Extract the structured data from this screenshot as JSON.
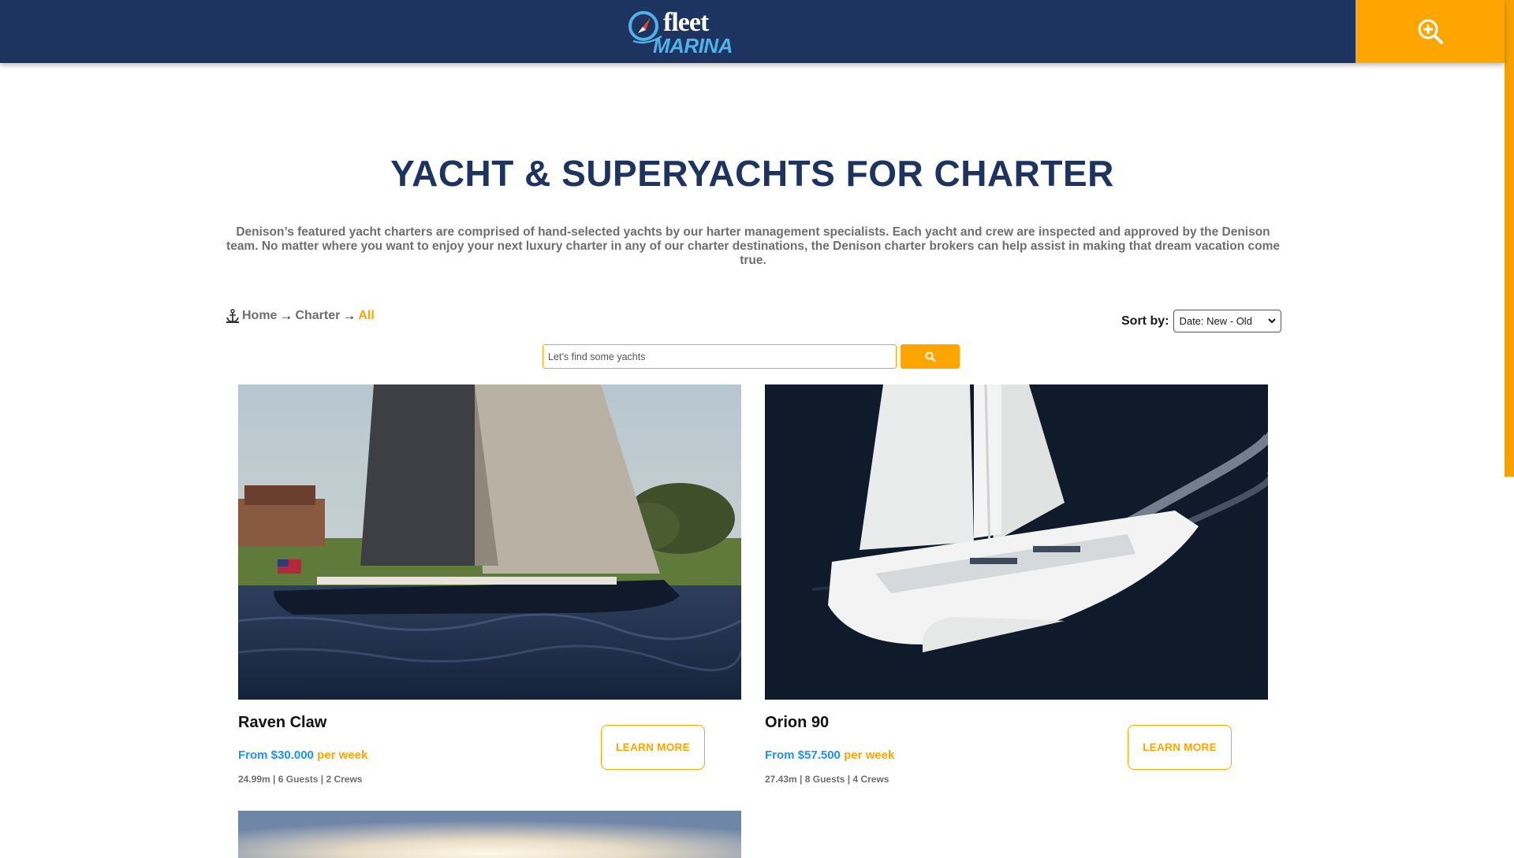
{
  "header": {
    "logo_word1": "fleet",
    "logo_word2": "MARINA",
    "search_icon": "zoom-in-icon",
    "colors": {
      "navy": "#1d3461",
      "accent": "#ffa500"
    }
  },
  "page": {
    "title": "YACHT & SUPERYACHTS FOR CHARTER",
    "intro": "Denison’s featured yacht charters are comprised of hand-selected yachts by our harter management specialists. Each yacht and crew are inspected and approved by the Denison team. No matter where you want to enjoy your next luxury charter in any of our charter destinations, the Denison charter brokers can help assist in making that dream vacation come true."
  },
  "breadcrumb": {
    "icon": "anchor-icon",
    "items": [
      "Home",
      "Charter",
      "All"
    ]
  },
  "sort": {
    "label": "Sort by:",
    "selected": "Date: New - Old"
  },
  "search": {
    "placeholder": "Let’s find some yachts",
    "button_icon": "search-icon"
  },
  "listings": [
    {
      "name": "Raven Claw",
      "price_prefix": "From",
      "price": "$30.000",
      "price_suffix": "per week",
      "specs": "24.99m | 6 Guests | 2 Crews",
      "button": "LEARN MORE"
    },
    {
      "name": "Orion 90",
      "price_prefix": "From",
      "price": "$57.500",
      "price_suffix": "per week",
      "specs": "27.43m | 8 Guests | 4 Crews",
      "button": "LEARN MORE"
    }
  ]
}
